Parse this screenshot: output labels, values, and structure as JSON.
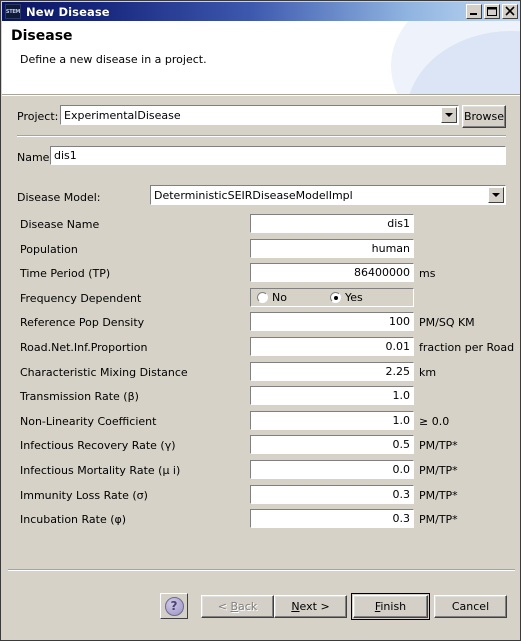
{
  "window": {
    "title": "New Disease",
    "icon": "stem-app-icon",
    "icon_text": "STEM",
    "controls": [
      {
        "name": "minimize",
        "glyph": "minimize-icon"
      },
      {
        "name": "maximize",
        "glyph": "maximize-icon"
      },
      {
        "name": "close",
        "glyph": "close-icon"
      }
    ]
  },
  "header": {
    "title": "Disease",
    "subtitle": "Define a new disease in a project."
  },
  "project": {
    "label": "Project:",
    "value": "ExperimentalDisease",
    "browse_label": "Browse"
  },
  "name": {
    "label": "Name:",
    "value": "dis1"
  },
  "disease_model": {
    "label": "Disease Model:",
    "value": "DeterministicSEIRDiseaseModelImpl"
  },
  "parameters": [
    {
      "label": "Disease Name",
      "value": "dis1",
      "unit": "",
      "align": "right",
      "type": "text"
    },
    {
      "label": "Population",
      "value": "human",
      "unit": "",
      "align": "right",
      "type": "text"
    },
    {
      "label": "Time Period (TP)",
      "value": "86400000",
      "unit": "ms",
      "align": "right",
      "type": "text"
    },
    {
      "label": "Frequency Dependent",
      "value": "Yes",
      "unit": "",
      "align": "right",
      "type": "radio",
      "options": [
        {
          "label": "No",
          "selected": false
        },
        {
          "label": "Yes",
          "selected": true
        }
      ]
    },
    {
      "label": "Reference Pop Density",
      "value": "100",
      "unit": "PM/SQ KM",
      "align": "right",
      "type": "text"
    },
    {
      "label": "Road.Net.Inf.Proportion",
      "value": "0.01",
      "unit": "fraction per Road",
      "align": "right",
      "type": "text"
    },
    {
      "label": "Characteristic Mixing Distance",
      "value": "2.25",
      "unit": "km",
      "align": "right",
      "type": "text"
    },
    {
      "label": "Transmission Rate (β)",
      "value": "1.0",
      "unit": "",
      "align": "right",
      "type": "text"
    },
    {
      "label": "Non-Linearity Coefficient",
      "value": "1.0",
      "unit": "≥ 0.0",
      "align": "right",
      "type": "text"
    },
    {
      "label": "Infectious Recovery Rate (γ)",
      "value": "0.5",
      "unit": "PM/TP*",
      "align": "right",
      "type": "text"
    },
    {
      "label": "Infectious Mortality Rate (μ i)",
      "value": "0.0",
      "unit": "PM/TP*",
      "align": "right",
      "type": "text"
    },
    {
      "label": "Immunity Loss Rate (σ)",
      "value": "0.3",
      "unit": "PM/TP*",
      "align": "right",
      "type": "text"
    },
    {
      "label": "Incubation Rate (φ)",
      "value": "0.3",
      "unit": "PM/TP*",
      "align": "right",
      "type": "text"
    }
  ],
  "buttons": {
    "help": "?",
    "back": "< Back",
    "back_mnemonic": "B",
    "back_enabled": false,
    "next": "Next >",
    "next_mnemonic": "N",
    "finish": "Finish",
    "finish_mnemonic": "F",
    "finish_default": true,
    "cancel": "Cancel"
  },
  "colors": {
    "dialog_background": "#d6d2c8",
    "title_dark": "#0a1560",
    "title_light": "#c3d9f2",
    "field_background": "#ffffff",
    "help_accent": "#a9a2cc"
  }
}
